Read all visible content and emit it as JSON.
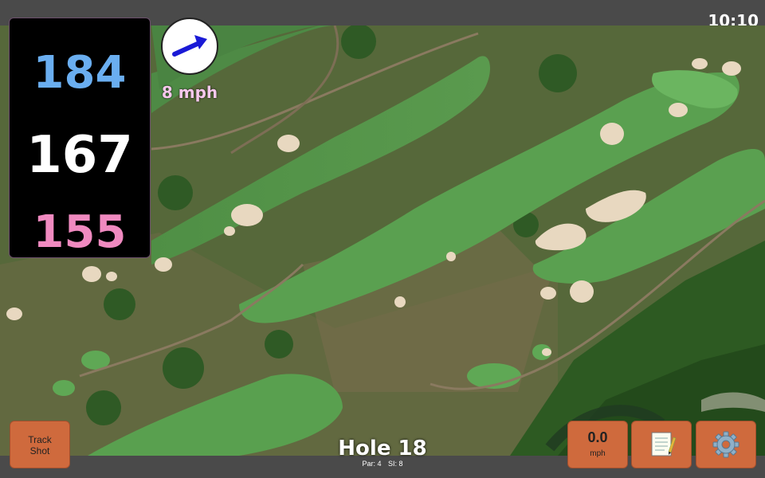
{
  "status_bar": {
    "time": "10:10"
  },
  "distances": {
    "back": "184",
    "middle": "167",
    "front": "155"
  },
  "wind": {
    "icon": "wind-direction-arrow-icon",
    "speed_label": "8 mph"
  },
  "buttons": {
    "track_shot_line1": "Track",
    "track_shot_line2": "Shot",
    "speed_value": "0.0",
    "speed_unit": "mph",
    "notes_icon": "notepad-icon",
    "settings_icon": "gear-icon"
  },
  "hole": {
    "title": "Hole 18",
    "par": "Par: 4",
    "si": "SI: 8"
  },
  "colors": {
    "back_distance": "#6aaef0",
    "middle_distance": "#ffffff",
    "front_distance": "#f08ac0",
    "button_bg": "#cf6a3d",
    "wind_arrow": "#1a1ad6"
  }
}
